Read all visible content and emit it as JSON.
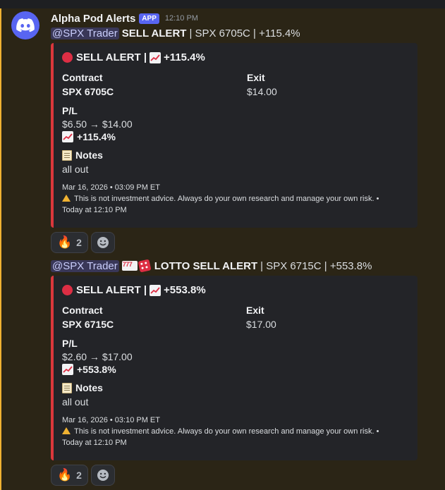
{
  "message": {
    "author": "Alpha Pod Alerts",
    "badge": "APP",
    "timestamp": "12:10 PM",
    "colors": {
      "accent": "#5865f2",
      "embed_bar": "#da373c",
      "mention_rail": "#f0b232"
    }
  },
  "posts": [
    {
      "mention": "@SPX Trader",
      "alert_type": "SELL ALERT",
      "summary": "| SPX 6705C | +115.4%",
      "embed": {
        "title_text": "SELL ALERT |",
        "title_pct": "+115.4%",
        "contract_label": "Contract",
        "contract_value": "SPX 6705C",
        "exit_label": "Exit",
        "exit_value": "$14.00",
        "pl_label": "P/L",
        "pl_range": "$6.50 → $14.00",
        "pl_pct": "+115.4%",
        "notes_label": "Notes",
        "notes_value": "all out",
        "date": "Mar 16, 2026 • 03:09 PM ET",
        "disclaimer": "This is not investment advice. Always do your own research and manage your own risk. •",
        "footer_time": "Today at 12:10 PM"
      },
      "reaction": {
        "emoji": "fire-emoji",
        "count": "2"
      }
    },
    {
      "mention": "@SPX Trader",
      "alert_type": "LOTTO SELL ALERT",
      "summary": "| SPX 6715C | +553.8%",
      "embed": {
        "title_text": "SELL ALERT |",
        "title_pct": "+553.8%",
        "contract_label": "Contract",
        "contract_value": "SPX 6715C",
        "exit_label": "Exit",
        "exit_value": "$17.00",
        "pl_label": "P/L",
        "pl_range": "$2.60 → $17.00",
        "pl_pct": "+553.8%",
        "notes_label": "Notes",
        "notes_value": "all out",
        "date": "Mar 16, 2026 • 03:10 PM ET",
        "disclaimer": "This is not investment advice. Always do your own research and manage your own risk. •",
        "footer_time": "Today at 12:10 PM"
      },
      "reaction": {
        "emoji": "fire-emoji",
        "count": "2"
      }
    }
  ]
}
